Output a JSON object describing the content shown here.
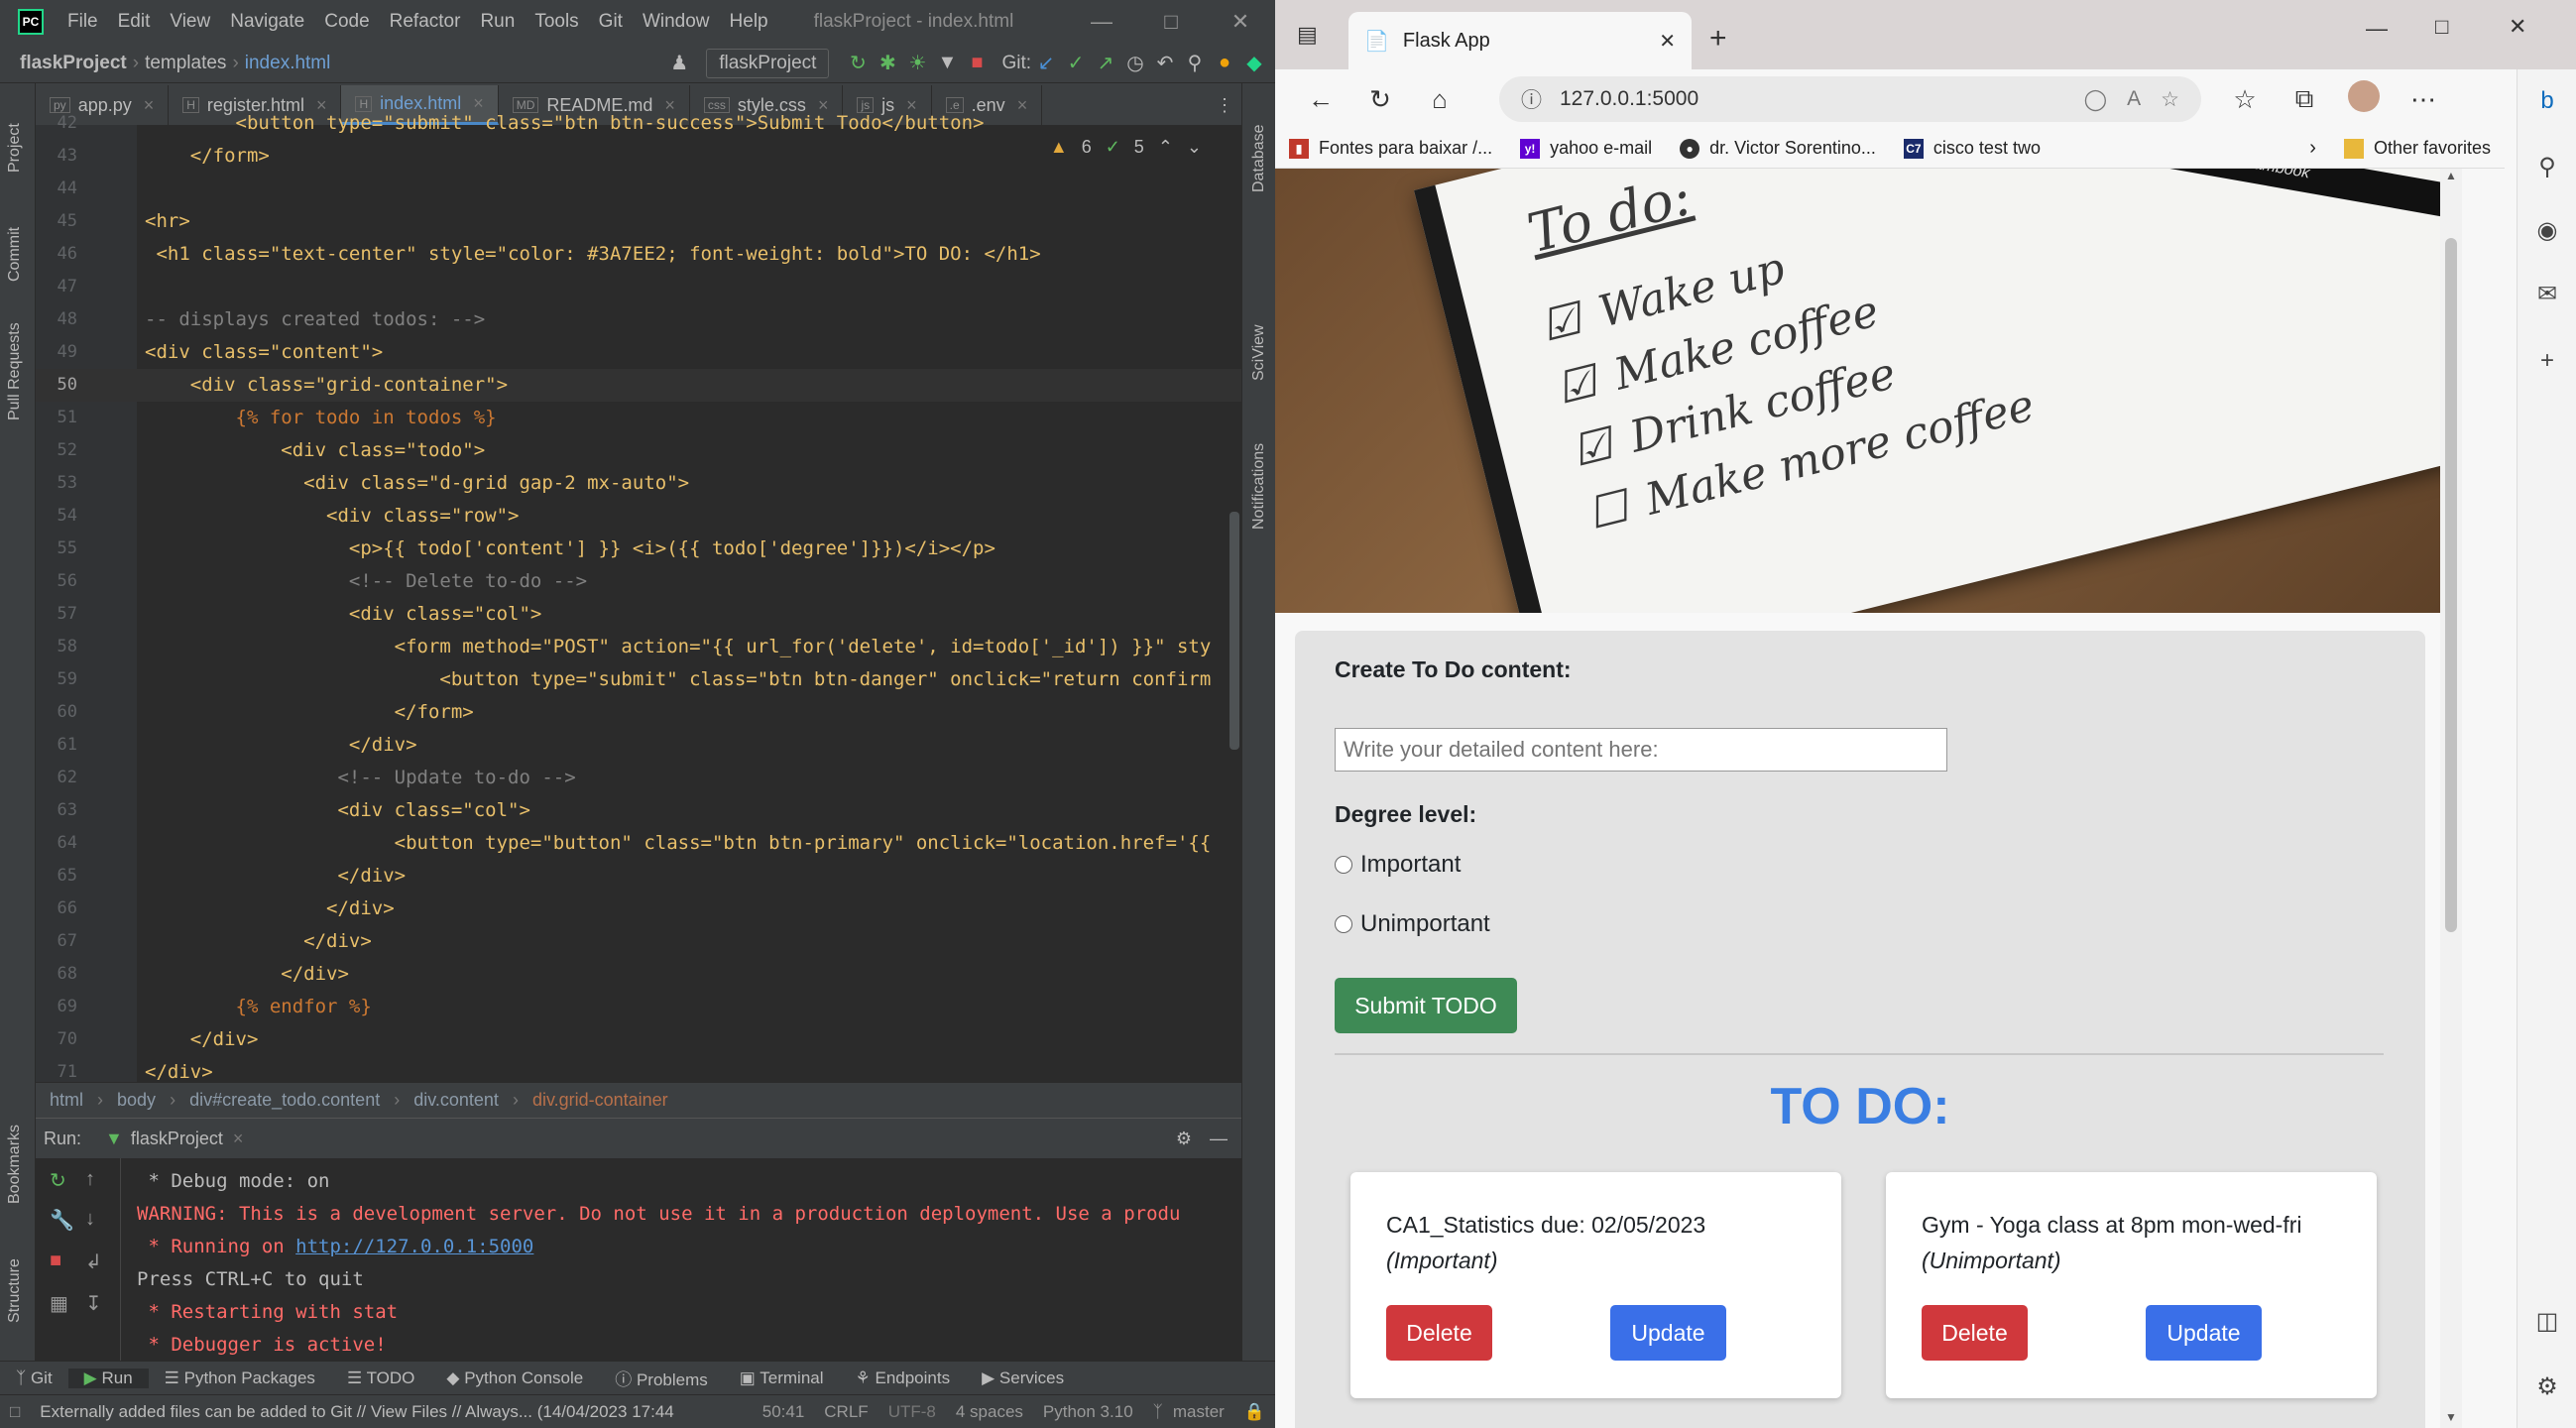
{
  "ide": {
    "menu": [
      "File",
      "Edit",
      "View",
      "Navigate",
      "Code",
      "Refactor",
      "Run",
      "Tools",
      "Git",
      "Window",
      "Help"
    ],
    "project_title": "flaskProject - index.html",
    "breadcrumb": {
      "project": "flaskProject",
      "folder": "templates",
      "file": "index.html"
    },
    "run_config": "flaskProject",
    "git_label": "Git:",
    "tabs": [
      "app.py",
      "register.html",
      "index.html",
      "README.md",
      "style.css",
      "js",
      ".env"
    ],
    "inspections": {
      "warnings": "6",
      "ok": "5"
    },
    "side_labels": [
      "Project",
      "Commit",
      "Pull Requests",
      "Bookmarks",
      "Structure"
    ],
    "right_labels": [
      "Database",
      "SciView",
      "Notifications"
    ],
    "code_lines": [
      {
        "n": "42",
        "t": "        <button type=\"submit\" class=\"btn btn-success\">Submit Todo</button>"
      },
      {
        "n": "43",
        "t": "    </form>"
      },
      {
        "n": "44",
        "t": ""
      },
      {
        "n": "45",
        "t": "<hr>"
      },
      {
        "n": "46",
        "t": " <h1 class=\"text-center\" style=\"color: #3A7EE2; font-weight: bold\">TO DO: </h1>"
      },
      {
        "n": "47",
        "t": ""
      },
      {
        "n": "48",
        "t": "-- displays created todos: -->"
      },
      {
        "n": "49",
        "t": "<div class=\"content\">"
      },
      {
        "n": "50",
        "t": "    <div class=\"grid-container\">"
      },
      {
        "n": "51",
        "t": "        {% for todo in todos %}"
      },
      {
        "n": "52",
        "t": "            <div class=\"todo\">"
      },
      {
        "n": "53",
        "t": "              <div class=\"d-grid gap-2 mx-auto\">"
      },
      {
        "n": "54",
        "t": "                <div class=\"row\">"
      },
      {
        "n": "55",
        "t": "                  <p>{{ todo['content'] }} <i>({{ todo['degree']}})</i></p>"
      },
      {
        "n": "56",
        "t": "                  <!-- Delete to-do -->"
      },
      {
        "n": "57",
        "t": "                  <div class=\"col\">"
      },
      {
        "n": "58",
        "t": "                      <form method=\"POST\" action=\"{{ url_for('delete', id=todo['_id']) }}\" sty"
      },
      {
        "n": "59",
        "t": "                          <button type=\"submit\" class=\"btn btn-danger\" onclick=\"return confirm"
      },
      {
        "n": "60",
        "t": "                      </form>"
      },
      {
        "n": "61",
        "t": "                  </div>"
      },
      {
        "n": "62",
        "t": "                 <!-- Update to-do -->"
      },
      {
        "n": "63",
        "t": "                 <div class=\"col\">"
      },
      {
        "n": "64",
        "t": "                      <button type=\"button\" class=\"btn btn-primary\" onclick=\"location.href='{{"
      },
      {
        "n": "65",
        "t": "                 </div>"
      },
      {
        "n": "66",
        "t": "                </div>"
      },
      {
        "n": "67",
        "t": "              </div>"
      },
      {
        "n": "68",
        "t": "            </div>"
      },
      {
        "n": "69",
        "t": "        {% endfor %}"
      },
      {
        "n": "70",
        "t": "    </div>"
      },
      {
        "n": "71",
        "t": "</div>"
      }
    ],
    "path_crumbs": [
      "html",
      "body",
      "div#create_todo.content",
      "div.content",
      "div.grid-container"
    ],
    "run": {
      "label": "Run:",
      "tab": "flaskProject",
      "output": [
        {
          "c": "w",
          "t": " * Debug mode: on"
        },
        {
          "c": "r",
          "t": "WARNING: This is a development server. Do not use it in a production deployment. Use a produ"
        },
        {
          "c": "r",
          "t": " * Running on "
        },
        {
          "c": "w",
          "t": "Press CTRL+C to quit"
        },
        {
          "c": "r",
          "t": " * Restarting with stat"
        },
        {
          "c": "r",
          "t": " * Debugger is active!"
        }
      ],
      "link": "http://127.0.0.1:5000"
    },
    "tool_windows": [
      "Git",
      "Run",
      "Python Packages",
      "TODO",
      "Python Console",
      "Problems",
      "Terminal",
      "Endpoints",
      "Services"
    ],
    "status": {
      "message": "Externally added files can be added to Git // View Files // Always... (14/04/2023 17:44",
      "pos": "50:41",
      "eol": "CRLF",
      "enc": "UTF-8",
      "indent": "4 spaces",
      "interp": "Python 3.10",
      "branch": "master"
    }
  },
  "browser": {
    "tab_title": "Flask App",
    "url": "127.0.0.1:5000",
    "favorites": [
      "Fontes para baixar /...",
      "yahoo e-mail",
      "dr. Victor Sorentino...",
      "cisco test two"
    ],
    "other_favorites": "Other favorites",
    "hero_note": {
      "title": "To do:",
      "items": [
        "Wake up",
        "Make coffee",
        "Drink coffee",
        "Make more coffee"
      ],
      "brand": "Bambook"
    },
    "form": {
      "content_label": "Create To Do content:",
      "content_placeholder": "Write your detailed content here:",
      "degree_label": "Degree level:",
      "options": [
        "Important",
        "Unimportant"
      ],
      "submit": "Submit TODO"
    },
    "todo_heading": "TO DO:",
    "todos": [
      {
        "content": "CA1_Statistics due: 02/05/2023",
        "degree": "(Important)",
        "delete": "Delete",
        "update": "Update"
      },
      {
        "content": "Gym - Yoga class at 8pm mon-wed-fri",
        "degree": "(Unimportant)",
        "delete": "Delete",
        "update": "Update"
      }
    ],
    "colors": {
      "accent": "#3a7ee2",
      "success": "#3e8a55",
      "danger": "#d0383c",
      "primary": "#3a6fe8"
    }
  }
}
